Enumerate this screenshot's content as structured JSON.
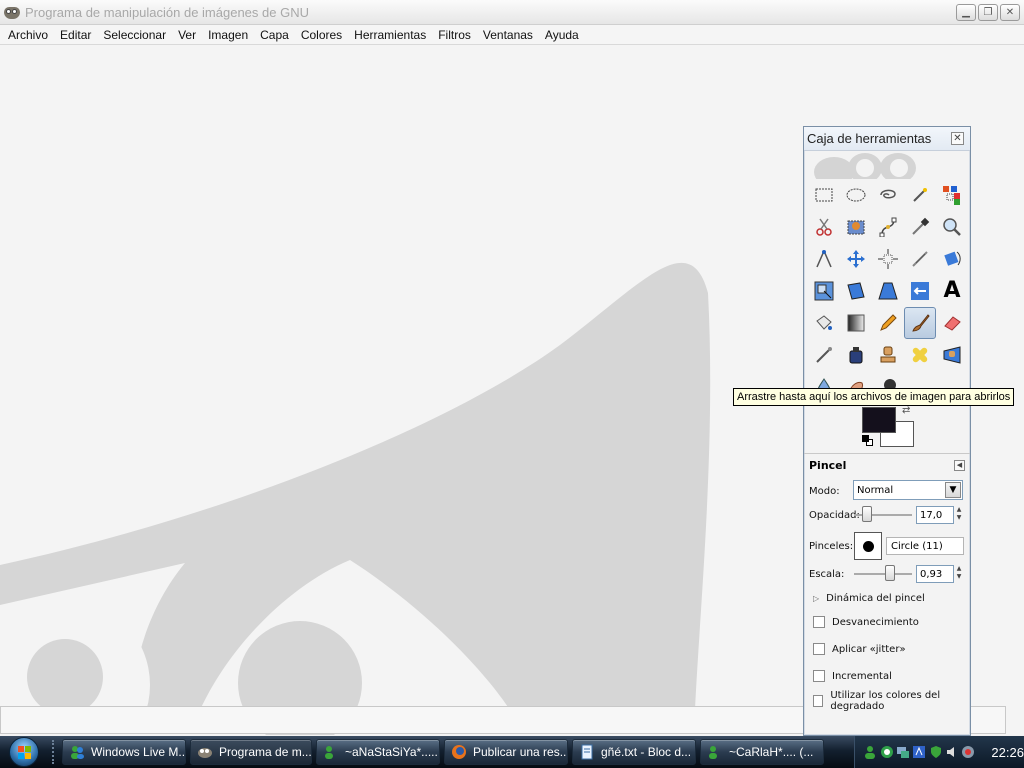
{
  "window": {
    "title": "Programa de manipulación de imágenes de GNU",
    "controls": {
      "minimize": "minimize-icon",
      "restore": "restore-icon",
      "close": "close-icon"
    }
  },
  "menu": [
    {
      "label": "Archivo"
    },
    {
      "label": "Editar"
    },
    {
      "label": "Seleccionar"
    },
    {
      "label": "Ver"
    },
    {
      "label": "Imagen"
    },
    {
      "label": "Capa"
    },
    {
      "label": "Colores"
    },
    {
      "label": "Herramientas"
    },
    {
      "label": "Filtros"
    },
    {
      "label": "Ventanas"
    },
    {
      "label": "Ayuda"
    }
  ],
  "toolbox": {
    "title": "Caja de herramientas",
    "tools": [
      "rectangle-select-icon",
      "ellipse-select-icon",
      "free-select-icon",
      "fuzzy-select-icon",
      "color-select-icon",
      "scissors-icon",
      "foreground-select-icon",
      "paths-icon",
      "color-picker-icon",
      "zoom-icon",
      "measure-icon",
      "move-icon",
      "align-icon",
      "crop-icon",
      "rotate-icon",
      "scale-icon",
      "shear-icon",
      "perspective-icon",
      "flip-icon",
      "text-icon",
      "bucket-fill-icon",
      "blend-icon",
      "pencil-icon",
      "paintbrush-icon",
      "eraser-icon",
      "airbrush-icon",
      "ink-icon",
      "clone-icon",
      "heal-icon",
      "perspective-clone-icon",
      "blur-icon",
      "smudge-icon",
      "dodge-burn-icon"
    ],
    "active_tool": "paintbrush-icon",
    "foreground_color": "#14101c",
    "background_color": "#ffffff",
    "tool_options": {
      "title": "Pincel",
      "mode_label": "Modo:",
      "mode_value": "Normal",
      "opacity_label": "Opacidad:",
      "opacity_value": "17,0",
      "brushes_label": "Pinceles:",
      "brush_name": "Circle (11)",
      "scale_label": "Escala:",
      "scale_value": "0,93",
      "dynamics_label": "Dinámica del pincel",
      "fade_label": "Desvanecimiento",
      "jitter_label": "Aplicar «jitter»",
      "incremental_label": "Incremental",
      "gradient_label": "Utilizar los colores del degradado"
    }
  },
  "tooltip": "Arrastre hasta aquí los archivos de imagen para abrirlos",
  "taskbar": {
    "tasks": [
      {
        "label": "Windows Live M...",
        "icon": "messenger-icon"
      },
      {
        "label": "Programa de m...",
        "icon": "gimp-icon"
      },
      {
        "label": "~aNaStaSiYa*.....",
        "icon": "messenger-icon"
      },
      {
        "label": "Publicar una res...",
        "icon": "firefox-icon"
      },
      {
        "label": "gñé.txt - Bloc d...",
        "icon": "notepad-icon"
      },
      {
        "label": "~CaRlaH*.... (...",
        "icon": "messenger-icon"
      }
    ],
    "tray_icons": [
      "messenger-status-icon",
      "network-icon",
      "connection-icon",
      "sound-icon",
      "security-icon",
      "volume-icon",
      "display-icon"
    ],
    "clock": "22:26"
  }
}
